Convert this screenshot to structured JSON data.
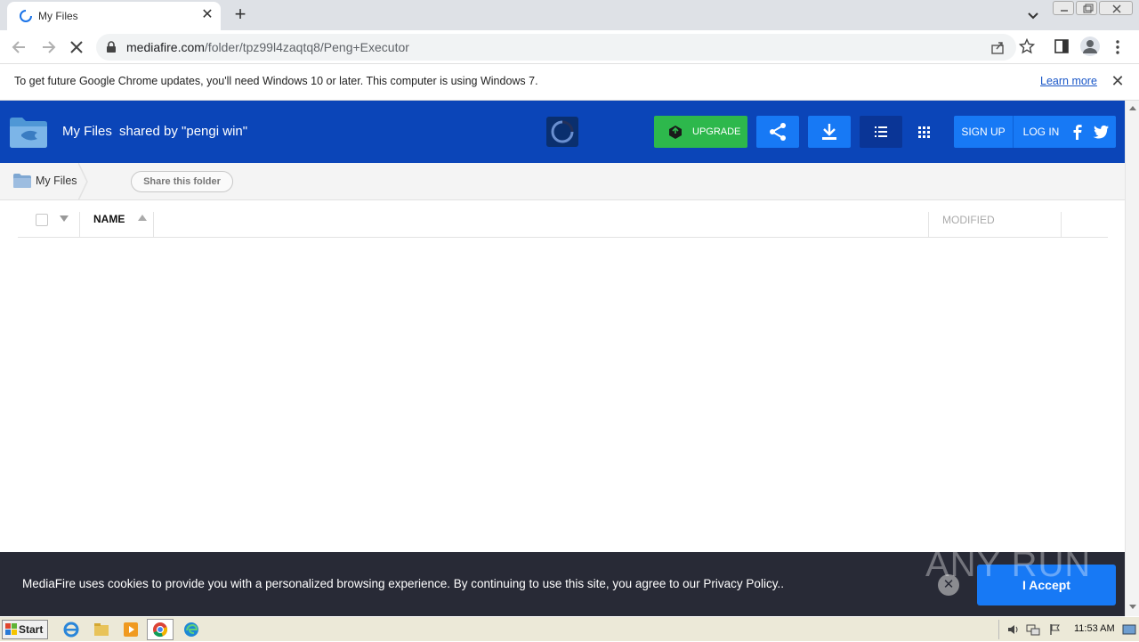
{
  "browser": {
    "tab_title": "My Files",
    "url_domain": "mediafire.com",
    "url_path": "/folder/tpz99l4zaqtq8/Peng+Executor"
  },
  "infobar": {
    "message": "To get future Google Chrome updates, you'll need Windows 10 or later. This computer is using Windows 7.",
    "link": "Learn more"
  },
  "header": {
    "title": "My Files",
    "shared_by": "shared by \"pengi win\"",
    "upgrade_label": "UPGRADE",
    "signup_label": "SIGN UP",
    "login_label": "LOG IN",
    "brand_color": "#0b45b8",
    "accent_color": "#1779f5",
    "upgrade_color": "#2db84c"
  },
  "breadcrumb": {
    "label": "My Files",
    "share_button": "Share this folder"
  },
  "listing": {
    "columns": [
      "NAME",
      "MODIFIED"
    ]
  },
  "cookie_banner": {
    "text": "MediaFire uses cookies to provide you with a personalized browsing experience. By continuing to use this site, you agree to our Privacy Policy..",
    "accept_label": "I Accept",
    "watermark": "ANY RUN"
  },
  "taskbar": {
    "start_label": "Start",
    "clock": "11:53 AM"
  }
}
